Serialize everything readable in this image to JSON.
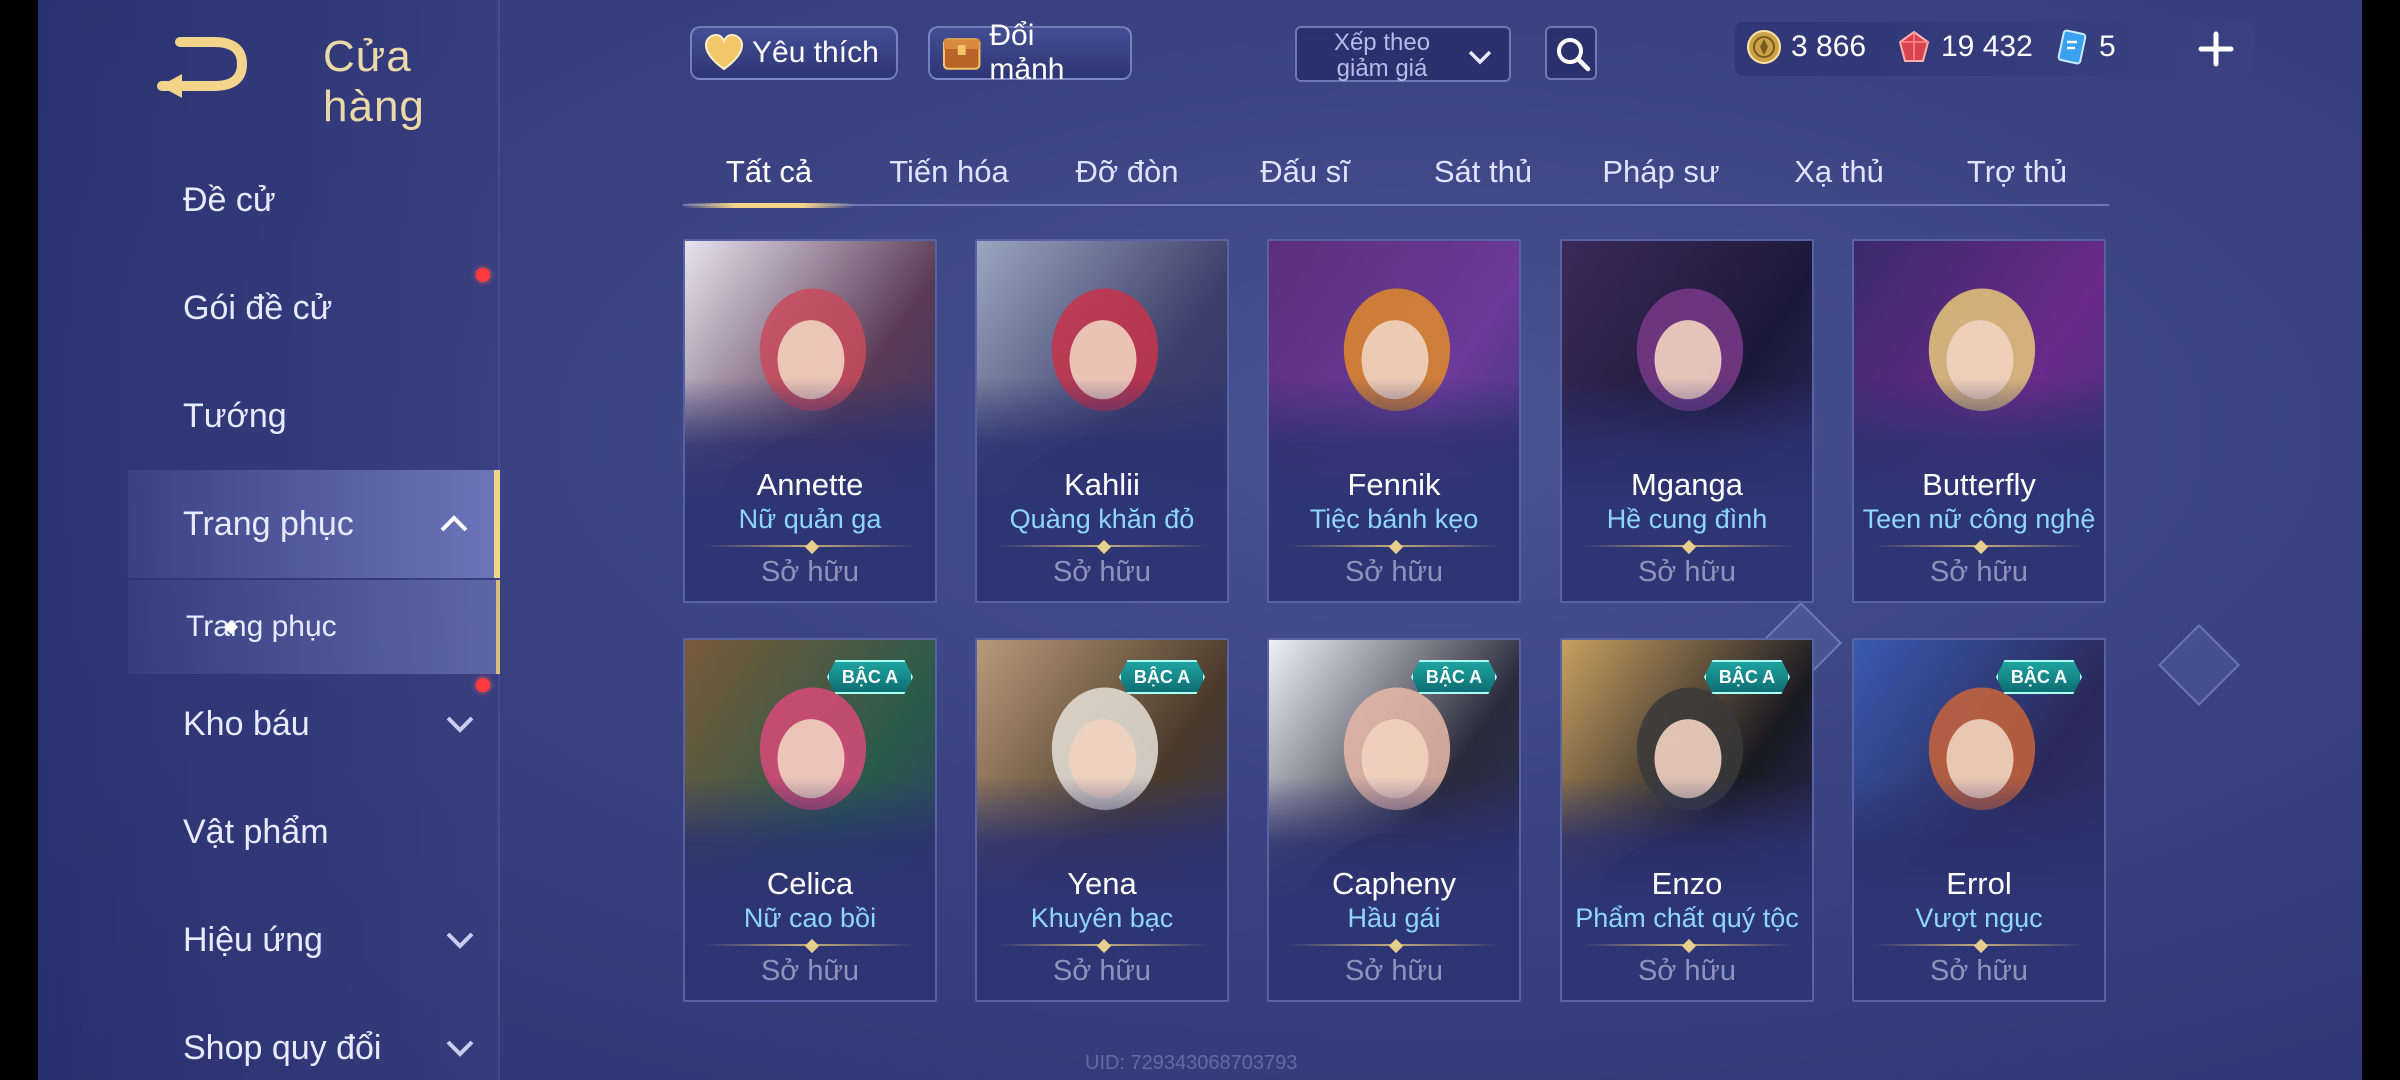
{
  "header": {
    "title": "Cửa hàng",
    "favorite_label": "Yêu thích",
    "shard_label": "Đổi mảnh",
    "sort_label": "Xếp theo giảm giá"
  },
  "currency": {
    "gold": "3 866",
    "ruby": "19 432",
    "gem": "5"
  },
  "sidebar": {
    "items": [
      {
        "label": "Đề cử"
      },
      {
        "label": "Gói đề cử"
      },
      {
        "label": "Tướng"
      },
      {
        "label": "Trang phục"
      },
      {
        "label": "Trang phục"
      },
      {
        "label": "Kho báu"
      },
      {
        "label": "Vật phẩm"
      },
      {
        "label": "Hiệu ứng"
      },
      {
        "label": "Shop quy đổi"
      }
    ]
  },
  "tabs": [
    "Tất cả",
    "Tiến hóa",
    "Đỡ đòn",
    "Đấu sĩ",
    "Sát thủ",
    "Pháp sư",
    "Xạ thủ",
    "Trợ thủ"
  ],
  "cards": [
    {
      "hero": "Annette",
      "skin": "Nữ quản ga",
      "status": "Sở hữu",
      "badge": "",
      "palette": [
        "#e7e3f0",
        "#c94a5a",
        "#5a3a55"
      ]
    },
    {
      "hero": "Kahlii",
      "skin": "Quàng khăn đỏ",
      "status": "Sở hữu",
      "badge": "",
      "palette": [
        "#9aa6c0",
        "#c8334a",
        "#3c3f6a"
      ]
    },
    {
      "hero": "Fennik",
      "skin": "Tiệc bánh kẹo",
      "status": "Sở hữu",
      "badge": "",
      "palette": [
        "#5a2f7a",
        "#e08a2a",
        "#6b3a9a"
      ]
    },
    {
      "hero": "Mganga",
      "skin": "Hề cung đình",
      "status": "Sở hữu",
      "badge": "",
      "palette": [
        "#3a2a5a",
        "#7a3a8a",
        "#1c1838"
      ]
    },
    {
      "hero": "Butterfly",
      "skin": "Teen nữ công nghệ",
      "status": "Sở hữu",
      "badge": "",
      "palette": [
        "#3a2a6a",
        "#e8c87a",
        "#6a2a8a"
      ]
    },
    {
      "hero": "Celica",
      "skin": "Nữ cao bồi",
      "status": "Sở hữu",
      "badge": "BẬC A",
      "palette": [
        "#7a5a3a",
        "#d84a7a",
        "#2a5a4a"
      ]
    },
    {
      "hero": "Yena",
      "skin": "Khuyên bạc",
      "status": "Sở hữu",
      "badge": "BẬC A",
      "palette": [
        "#b89a7a",
        "#e8e0d8",
        "#4a3a2a"
      ]
    },
    {
      "hero": "Capheny",
      "skin": "Hầu gái",
      "status": "Sở hữu",
      "badge": "BẬC A",
      "palette": [
        "#f0f0f8",
        "#e8b8a8",
        "#2a2a3a"
      ]
    },
    {
      "hero": "Enzo",
      "skin": "Phẩm chất quý tộc",
      "status": "Sở hữu",
      "badge": "BẬC A",
      "palette": [
        "#c8a060",
        "#3a3a3a",
        "#1a1a22"
      ]
    },
    {
      "hero": "Errol",
      "skin": "Vượt ngục",
      "status": "Sở hữu",
      "badge": "BẬC A",
      "palette": [
        "#3a5ab0",
        "#c8643a",
        "#2a2a5a"
      ]
    }
  ],
  "footer": {
    "uid": "UID: 729343068703793"
  },
  "colors": {
    "accent_gold": "#f2d48a",
    "skin_name": "#8fd6ff",
    "notification": "#ff3b3b"
  }
}
